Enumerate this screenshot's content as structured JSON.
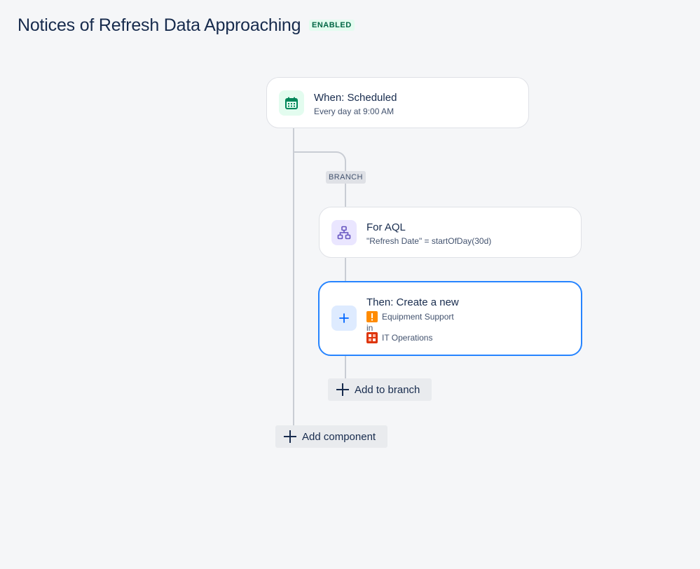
{
  "header": {
    "title": "Notices of Refresh Data Approaching",
    "status": "ENABLED"
  },
  "trigger": {
    "title": "When: Scheduled",
    "subtitle": "Every day at 9:00 AM",
    "icon": "calendar-icon",
    "icon_bg": "#e3fcef",
    "icon_color": "#00875a"
  },
  "branch": {
    "label": "BRANCH"
  },
  "branch_condition": {
    "title": "For AQL",
    "subtitle": "\"Refresh Date\" = startOfDay(30d)",
    "icon": "hierarchy-icon",
    "icon_bg": "#eae6ff",
    "icon_color": "#6554c0"
  },
  "action": {
    "title": "Then: Create a new",
    "issue_type": "Equipment Support",
    "connector": "in",
    "project": "IT Operations",
    "icon": "plus-icon",
    "icon_bg": "#deebff",
    "icon_color": "#0065ff",
    "selected_border": "#2684ff"
  },
  "buttons": {
    "add_to_branch": "Add to branch",
    "add_component": "Add component"
  }
}
